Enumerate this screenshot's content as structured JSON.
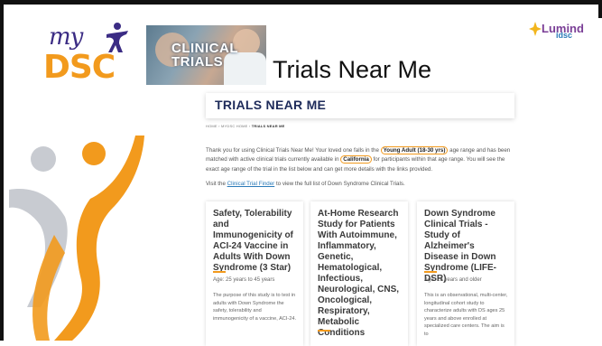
{
  "header": {
    "logo_my": "my",
    "logo_dsc": "DSC",
    "clinical_line1": "CLINICAL",
    "clinical_line2": "TRIALS",
    "page_title": "Trials Near Me",
    "partner_logo_top": "Lumind",
    "partner_logo_bottom": "idsc"
  },
  "banner": {
    "title": "TRIALS NEAR ME"
  },
  "breadcrumb": {
    "home": "HOME",
    "mydsc": "MYDSC HOME",
    "current": "TRIALS NEAR ME",
    "sep": "›"
  },
  "intro": {
    "part1": "Thank you for using Clinical Trials Near Me! Your loved one falls in the ",
    "age_group": "Young Adult (18-30 yrs)",
    "part2": " age range and has been matched with active clinical trials currently available in ",
    "location": "California",
    "part3": " for participants within that age range. You will see the exact age range of the trial in the list below and can get more details with the links provided.",
    "visit_prefix": "Visit the ",
    "visit_link": "Clinical Trial Finder",
    "visit_suffix": " to view the full list of Down Syndrome Clinical Trials."
  },
  "cards": [
    {
      "title": "Safety, Tolerability and Immunogenicity of ACI-24 Vaccine in Adults With Down Syndrome (3 Star)",
      "age": "Age: 25 years to 45 years",
      "desc": "The purpose of this study is to test in adults with Down Syndrome the safety, tolerability and immunogenicity of a vaccine, ACI-24."
    },
    {
      "title": "At-Home Research Study for Patients With Autoimmune, Inflammatory, Genetic, Hematological, Infectious, Neurological, CNS, Oncological, Respiratory, Metabolic Conditions",
      "age": "",
      "desc": ""
    },
    {
      "title": "Down Syndrome Clinical Trials - Study of Alzheimer's Disease in Down Syndrome (LIFE-DSR)",
      "age": "Age: 25 years and older",
      "desc": "This is an observational, multi-center, longitudinal cohort study to characterize adults with DS ages 25 years and above enrolled at specialized care centers. The aim is to"
    }
  ],
  "colors": {
    "orange": "#f29a1d",
    "purple": "#3b2c84",
    "navy": "#1e2b5a",
    "link": "#2a7ab8"
  }
}
